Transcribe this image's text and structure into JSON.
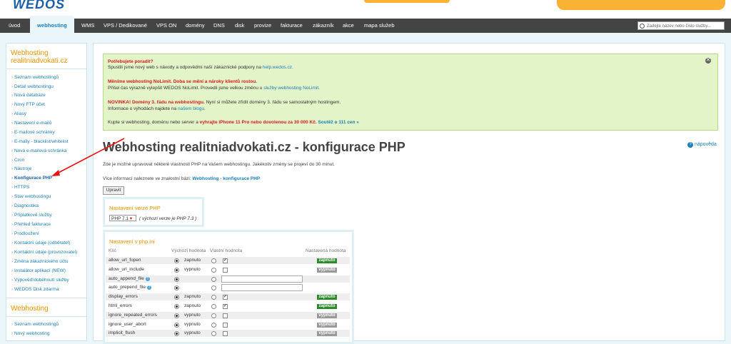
{
  "logo": "WEDOS",
  "nav": {
    "items": [
      "úvod",
      "webhosting",
      "WMS",
      "VPS / Dedikované",
      "VPS ON",
      "domény",
      "DNS",
      "disk",
      "provize",
      "fakturace",
      "zákazník",
      "akce",
      "mapa služeb"
    ],
    "active": "webhosting",
    "search_placeholder": "Zadejte název nebo číslo služby..."
  },
  "sidebar": {
    "title1": "Webhosting",
    "title2": "realitniadvokati.cz",
    "items": [
      "Seznam webhostingů",
      "Detail webhostingu",
      "Nová databáze",
      "Nový FTP účet",
      "Aliasy",
      "Nastavení e-mailů",
      "E-mailové schránky",
      "E-maily - blacklist/whitelist",
      "Nová e-mailová schránka",
      "Cron",
      "Nástroje",
      "Konfigurace PHP",
      "HTTPS",
      "Stav webhostingu",
      "Diagnostika",
      "Příplatkové služby",
      "Přehled fakturace",
      "Prodloužení",
      "Kontaktní údaje (odběratel)",
      "Kontaktní údaje (provozovatel)",
      "Změna zákaznického účtu",
      "Instalátor aplikací (NEW)",
      "Výpověď/doběhnutí služby",
      "WEDOS Disk zdarma"
    ],
    "current": "Konfigurace PHP",
    "title3": "Webhosting",
    "items2": [
      "Seznam webhostingů",
      "Nový webhosting"
    ]
  },
  "notice": {
    "l1_red": "Potřebujete poradit?",
    "l1_txt": "Spustili jsme nový web s návody a odpovědmi naší zákaznické podpory na ",
    "l1_link": "help.wedos.cz.",
    "l2_red": "Měníme webhosting NoLimit. Doba se mění a nároky klientů rostou.",
    "l2_txt": "Přišel čas výrazně vylepšit WEDOS NoLimit. Provedli jsme velkou změnu u ",
    "l2_link": "služby webhosting NoLimit.",
    "l3_red": "NOVINKA! Domény 3. řádu na webhostingu.",
    "l3_txt": " Nyní si můžete zřídit domény 3. řádu se samostatným hostingem.",
    "l3b_txt": "Informace o výhodách najdete na ",
    "l3b_link": "našem blogu.",
    "l4_txt": "Kupte si webhosting, doménu nebo server a ",
    "l4_red": "vyhrajte iPhone 11 Pro nebo dovolenou za 30 000 Kč.",
    "l4_link": " Soutěž o 111 cen »",
    "close": "✕"
  },
  "help": "nápověda",
  "page_title": "Webhosting realitniadvokati.cz - konfigurace PHP",
  "desc": "Zde je možné upravovat některé vlastnosti PHP na Vašem webhostingu. Jakékoliv změny se projeví do 30 minut.",
  "kb_txt": "Více informací naleznete ve znalostní bázi: ",
  "kb_link": "Webhosting - konfigurace PHP",
  "edit_button": "Upravit",
  "php_version": {
    "title": "Nastavení verze PHP",
    "selected": "PHP 7.1",
    "note": "( výchozí verze je  PHP 7.3 )"
  },
  "ini": {
    "title": "Nastavení v php.ini",
    "headers": [
      "Klíč",
      "Výchozí hodnota",
      "Vlastní hodnota",
      "Nastavená hodnota"
    ],
    "rows": [
      {
        "key": "allow_url_fopen",
        "def": "zapnuto",
        "custom": true,
        "set": "zapnuto"
      },
      {
        "key": "allow_url_include",
        "def": "vypnuto",
        "custom": false,
        "set": "vypnuto"
      },
      {
        "key": "auto_append_file",
        "def": "",
        "custom": null,
        "set": ""
      },
      {
        "key": "auto_prepend_file",
        "def": "",
        "custom": null,
        "set": ""
      },
      {
        "key": "display_errors",
        "def": "zapnuto",
        "custom": true,
        "set": "zapnuto"
      },
      {
        "key": "html_errors",
        "def": "zapnuto",
        "custom": true,
        "set": "zapnuto"
      },
      {
        "key": "ignore_repeated_errors",
        "def": "vypnuto",
        "custom": false,
        "set": "vypnuto"
      },
      {
        "key": "ignore_user_abort",
        "def": "vypnuto",
        "custom": false,
        "set": "vypnuto"
      },
      {
        "key": "implicit_flush",
        "def": "vypnuto",
        "custom": false,
        "set": "vypnuto"
      }
    ]
  }
}
